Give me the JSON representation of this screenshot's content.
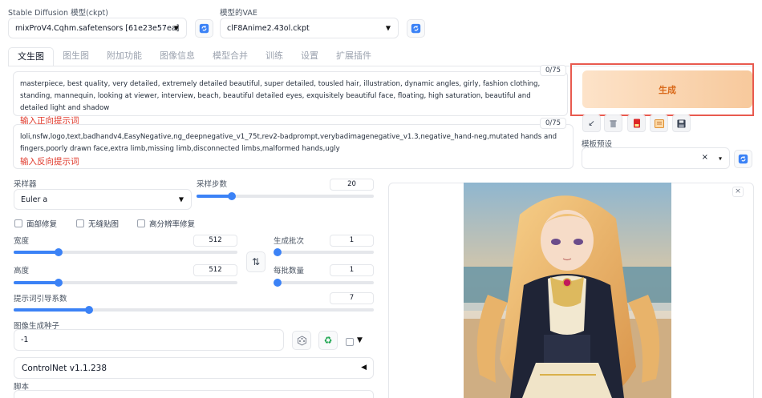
{
  "models": {
    "ckpt_label": "Stable Diffusion 模型(ckpt)",
    "ckpt_value": "mixProV4.Cqhm.safetensors [61e23e57ea]",
    "vae_label": "模型的VAE",
    "vae_value": "clF8Anime2.43ol.ckpt",
    "refresh_icon": "refresh-icon"
  },
  "tabs": [
    {
      "label": "文生图",
      "active": true
    },
    {
      "label": "图生图"
    },
    {
      "label": "附加功能"
    },
    {
      "label": "图像信息"
    },
    {
      "label": "模型合并"
    },
    {
      "label": "训练"
    },
    {
      "label": "设置"
    },
    {
      "label": "扩展插件"
    }
  ],
  "prompt": {
    "positive_text": "masterpiece, best quality, very detailed, extremely detailed beautiful, super detailed, tousled hair, illustration, dynamic angles, girly, fashion clothing, standing, mannequin, looking at viewer, interview, beach, beautiful detailed eyes, exquisitely beautiful face, floating, high saturation, beautiful and detailed light and shadow",
    "positive_hint": "输入正向提示词",
    "positive_count": "0/75",
    "negative_text": "loli,nsfw,logo,text,badhandv4,EasyNegative,ng_deepnegative_v1_75t,rev2-badprompt,verybadimagenegative_v1.3,negative_hand-neg,mutated hands and fingers,poorly drawn face,extra limb,missing limb,disconnected limbs,malformed hands,ugly",
    "negative_hint": "输入反向提示词",
    "negative_count": "0/75"
  },
  "generate": {
    "label": "生成",
    "template_label": "模板预设",
    "template_clear": "×",
    "template_caret": "▾",
    "tool_icons": [
      "arrow-down-left-icon",
      "trash-icon",
      "red-book-icon",
      "notebook-icon",
      "save-icon"
    ]
  },
  "sampler": {
    "label": "采样器",
    "value": "Euler a",
    "steps_label": "采样步数",
    "steps_value": "20",
    "steps_fraction": 0.2
  },
  "options": {
    "face_fix": "面部修复",
    "tiling": "无缝贴图",
    "hires_fix": "高分辨率修复"
  },
  "size": {
    "width_label": "宽度",
    "width_value": "512",
    "width_fraction": 0.2,
    "height_label": "高度",
    "height_value": "512",
    "height_fraction": 0.2,
    "swap_icon": "swap-icon"
  },
  "batch": {
    "count_label": "生成批次",
    "count_value": "1",
    "count_fraction": 0.0,
    "size_label": "每批数量",
    "size_value": "1",
    "size_fraction": 0.0
  },
  "cfg": {
    "label": "提示词引导系数",
    "value": "7",
    "fraction": 0.21
  },
  "seed": {
    "label": "图像生成种子",
    "value": "-1",
    "dice_icon": "dice-icon",
    "recycle_icon": "recycle-icon",
    "extra_caret": "▼"
  },
  "controlnet": {
    "label": "ControlNet v1.1.238",
    "caret": "◀"
  },
  "script": {
    "label": "脚本"
  },
  "output": {
    "close": "×"
  },
  "colors": {
    "accent": "#3b82f6",
    "generate_text": "#d9691a",
    "highlight_border": "#e85a4f",
    "hint_red": "#e0392b"
  }
}
